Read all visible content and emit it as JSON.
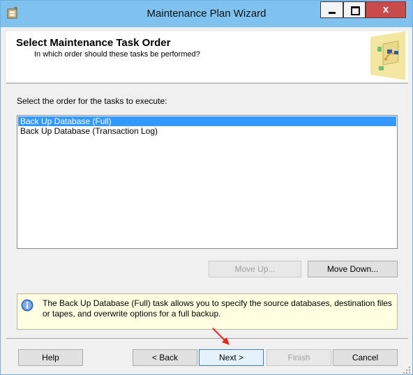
{
  "window": {
    "title": "Maintenance Plan Wizard",
    "close_glyph": "x",
    "icons": {
      "app": "wizard-app-icon",
      "minimize": "minimize-icon",
      "maximize": "maximize-icon",
      "close": "close-icon"
    }
  },
  "header": {
    "title": "Select Maintenance Task Order",
    "subtitle": "In which order should these tasks be performed?",
    "art_icon": "wizard-illustration-icon"
  },
  "task_list": {
    "label": "Select the order for the tasks to execute:",
    "items": [
      {
        "label": "Back Up Database (Full)",
        "selected": true
      },
      {
        "label": "Back Up Database (Transaction Log)",
        "selected": false
      }
    ]
  },
  "order_buttons": {
    "move_up": "Move Up...",
    "move_up_enabled": false,
    "move_down": "Move Down...",
    "move_down_enabled": true
  },
  "info": {
    "icon": "info-icon",
    "text": "The Back Up Database (Full) task allows you to specify the source databases, destination files or tapes, and overwrite options for a full backup."
  },
  "footer": {
    "help": "Help",
    "back": "< Back",
    "next": "Next >",
    "finish": "Finish",
    "finish_enabled": false,
    "cancel": "Cancel"
  },
  "annotation": {
    "arrow_icon": "red-arrow-icon",
    "color": "#e8261f"
  },
  "colors": {
    "titlebar": "#7fc1ef",
    "selection": "#3399ff",
    "close_button": "#c94a4a",
    "info_background": "#ffffe1"
  }
}
